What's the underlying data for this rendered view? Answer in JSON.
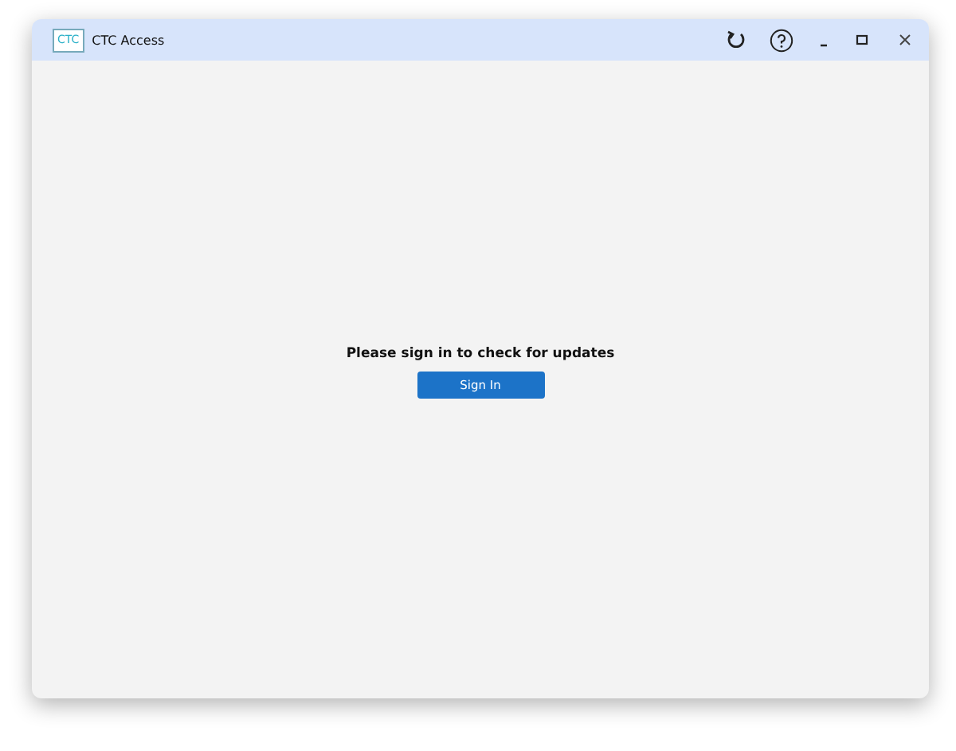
{
  "window": {
    "logo": "CTC",
    "title": "CTC Access"
  },
  "message": "Please sign in to check for updates",
  "button": "Sign In"
}
